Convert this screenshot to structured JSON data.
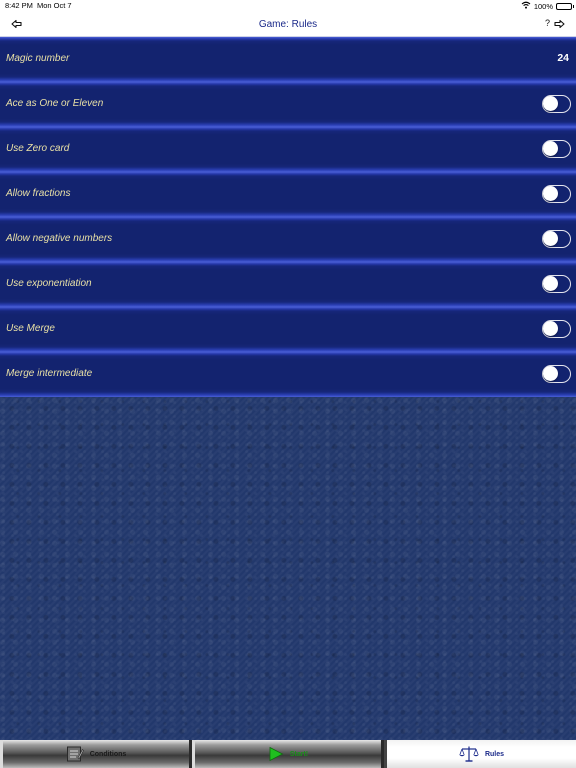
{
  "status_bar": {
    "time": "8:42 PM",
    "date": "Mon Oct 7",
    "battery": "100%",
    "wifi_icon": "wifi-icon",
    "battery_icon": "battery-icon"
  },
  "nav": {
    "title": "Game: Rules",
    "back_icon": "back-arrow-icon",
    "help_label": "?",
    "forward_icon": "forward-arrow-icon"
  },
  "rules": {
    "magic_number": {
      "label": "Magic number",
      "value": "24"
    },
    "options": [
      {
        "label": "Ace as One or Eleven",
        "enabled": false
      },
      {
        "label": "Use Zero card",
        "enabled": false
      },
      {
        "label": "Allow fractions",
        "enabled": false
      },
      {
        "label": "Allow negative numbers",
        "enabled": false
      },
      {
        "label": "Use exponentiation",
        "enabled": false
      },
      {
        "label": "Use Merge",
        "enabled": false
      },
      {
        "label": "Merge intermediate",
        "enabled": false
      }
    ]
  },
  "tabs": [
    {
      "label": "Conditions",
      "icon": "notepad-icon",
      "selected": false
    },
    {
      "label": "Start!",
      "icon": "play-icon",
      "selected": false
    },
    {
      "label": "Rules",
      "icon": "balance-scale-icon",
      "selected": true
    }
  ],
  "colors": {
    "row_background": "#13236f",
    "row_highlight": "#4a5fd6",
    "label_text": "#e8e0a6",
    "title_text": "#1b2a8a",
    "texture_background": "#22386c",
    "start_green": "#1a8f1a"
  }
}
